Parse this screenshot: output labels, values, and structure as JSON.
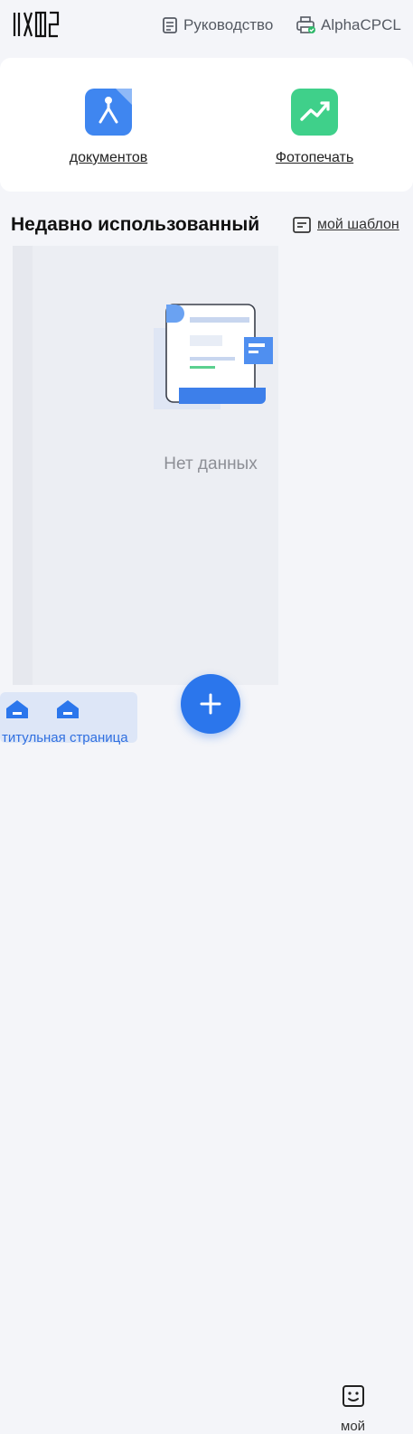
{
  "header": {
    "guide_label": "Руководство",
    "printer_label": "AlphaCPCL"
  },
  "features": [
    {
      "label": "документов",
      "icon": "pdf-document-icon",
      "color": "#3f86f0"
    },
    {
      "label": "Фотопечать",
      "icon": "photo-chart-icon",
      "color": "#3fd08a"
    }
  ],
  "recent": {
    "title": "Недавно использованный",
    "template_link": "мой шаблон",
    "empty_text": "Нет данных"
  },
  "tabbar": {
    "home_label": "титульная страница",
    "my_label": "мой",
    "accent": "#2b76ec"
  }
}
